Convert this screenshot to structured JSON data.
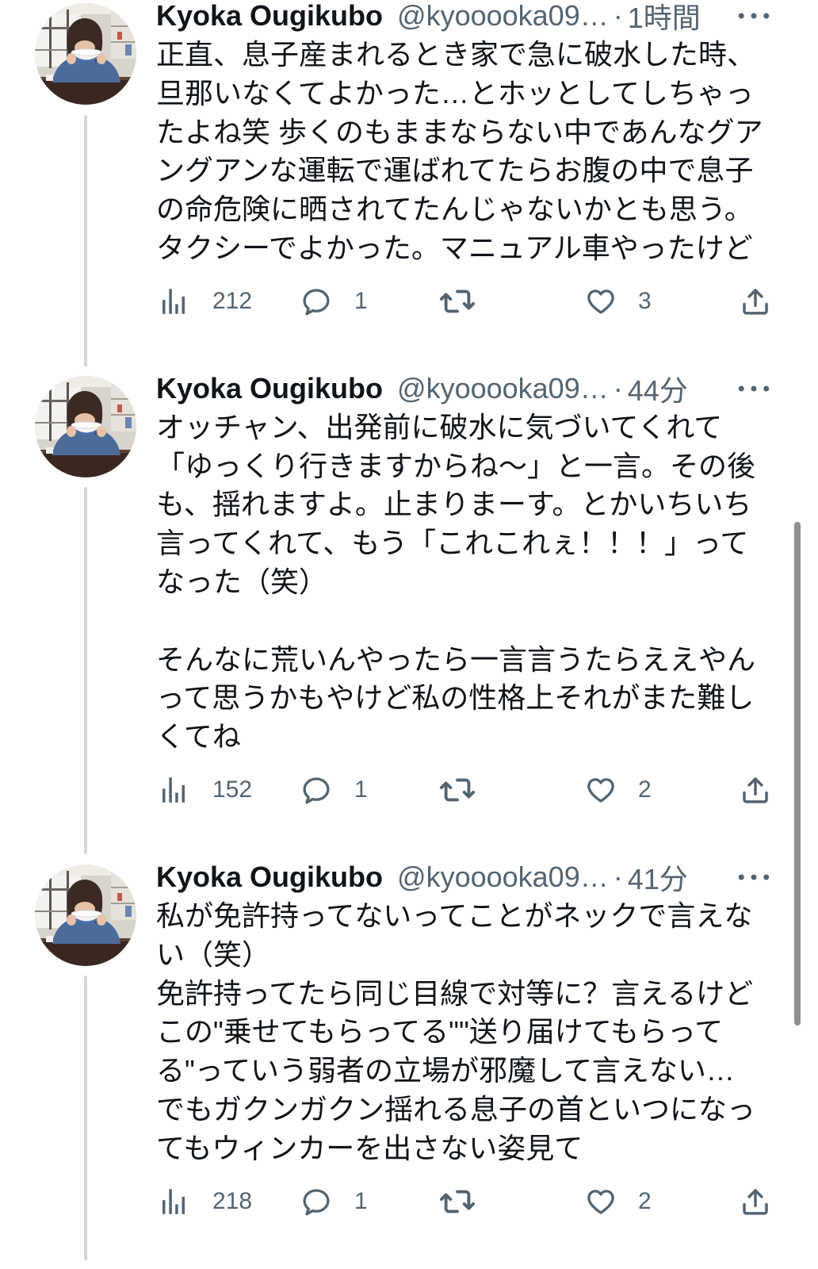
{
  "tweets": [
    {
      "author_name": "Kyoka Ougikubo",
      "handle": "@kyooooka09…",
      "separator": "·",
      "time": "1時間",
      "paragraphs": [
        [
          "正直、息子産まれるとき家で急に破水した時、",
          "旦那いなくてよかった…とホッとしてしちゃっ",
          "たよね笑 歩くのもままならない中であんなグア",
          "ングアンな運転で運ばれてたらお腹の中で息子",
          "の命危険に晒されてたんじゃないかとも思う。",
          "タクシーでよかった。マニュアル車やったけど"
        ]
      ],
      "actions": {
        "views": "212",
        "replies": "1",
        "likes": "3"
      }
    },
    {
      "author_name": "Kyoka Ougikubo",
      "handle": "@kyooooka09…",
      "separator": "·",
      "time": "44分",
      "paragraphs": [
        [
          "オッチャン、出発前に破水に気づいてくれて",
          "「ゆっくり行きますからね〜」と一言。その後",
          "も、揺れますよ。止まりまーす。とかいちいち",
          "言ってくれて、もう「これこれぇ！！！」って",
          "なった（笑）"
        ],
        [
          "そんなに荒いんやったら一言言うたらええやん",
          "って思うかもやけど私の性格上それがまた難し",
          "くてね"
        ]
      ],
      "actions": {
        "views": "152",
        "replies": "1",
        "likes": "2"
      }
    },
    {
      "author_name": "Kyoka Ougikubo",
      "handle": "@kyooooka09…",
      "separator": "·",
      "time": "41分",
      "paragraphs": [
        [
          "私が免許持ってないってことがネックで言えな",
          "い（笑）",
          "免許持ってたら同じ目線で対等に？言えるけど",
          "この\"乗せてもらってる\"\"送り届けてもらって",
          "る\"っていう弱者の立場が邪魔して言えない…",
          "でもガクンガクン揺れる息子の首といつになっ",
          "てもウィンカーを出さない姿見て"
        ]
      ],
      "actions": {
        "views": "218",
        "replies": "1",
        "likes": "2"
      }
    }
  ],
  "icons": {
    "views": "bar-chart-icon",
    "reply": "speech-bubble-icon",
    "retweet": "retweet-icon",
    "like": "heart-icon",
    "share": "share-icon",
    "more": "more-dots-icon"
  },
  "colors": {
    "text": "#0f1419",
    "secondary": "#536471",
    "thread_line": "#cfd9de",
    "background": "#ffffff",
    "scrollbar": "#8e8e93"
  }
}
